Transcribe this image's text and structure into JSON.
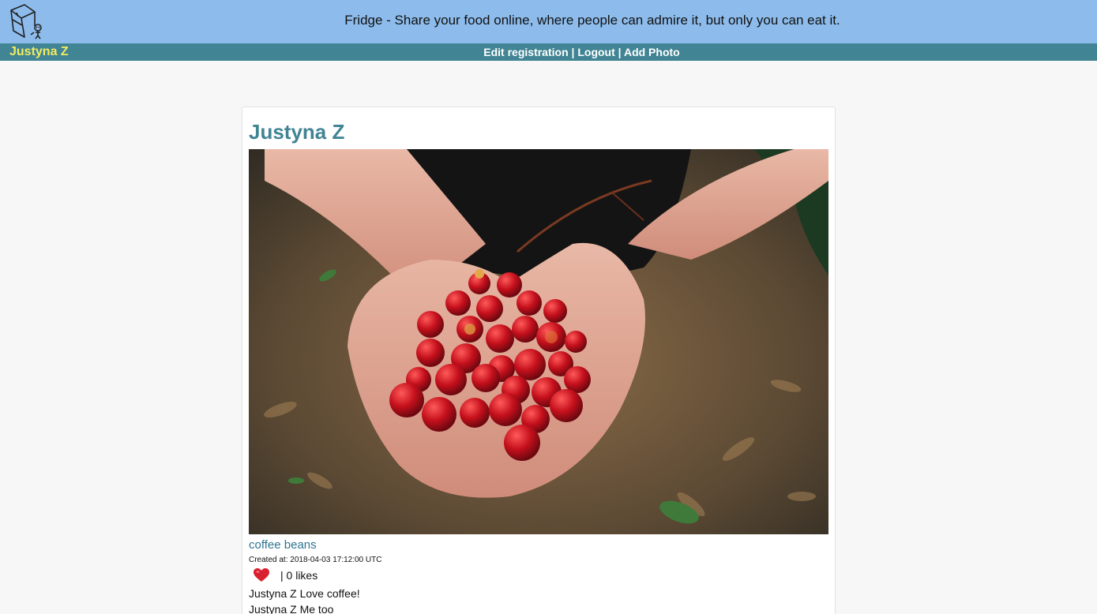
{
  "header": {
    "tagline": "Fridge - Share your food online, where people can admire it, but only you can eat it.",
    "logo_icon": "fridge-logo-icon"
  },
  "nav": {
    "user_name": "Justyna Z",
    "links": [
      "Edit registration",
      "Logout",
      "Add Photo"
    ],
    "separator": " | "
  },
  "profile": {
    "name": "Justyna Z"
  },
  "photo": {
    "title": "coffee beans",
    "created_label": "Created at:",
    "created_value": "2018-04-03 17:12:00 UTC",
    "like_icon": "heart-icon",
    "likes_text": "| 0 likes"
  },
  "comments": [
    {
      "author": "Justyna Z",
      "text": "Love coffee!"
    },
    {
      "author": "Justyna Z",
      "text": "Me too"
    }
  ],
  "colors": {
    "header_bg": "#8dbcec",
    "nav_bg": "#418494",
    "nav_user": "#f2ec5e",
    "accent": "#418494",
    "heart": "#d9202f"
  }
}
